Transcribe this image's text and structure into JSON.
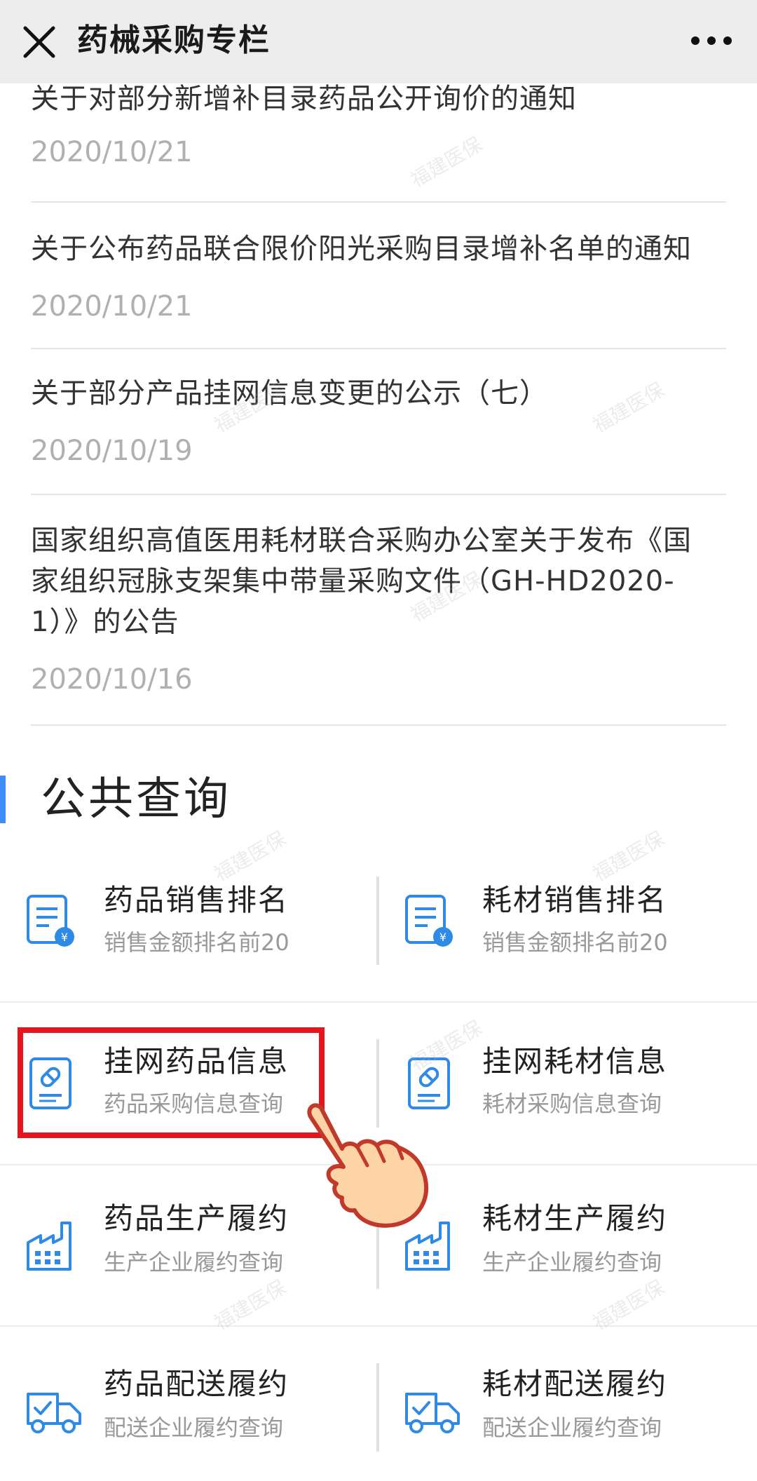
{
  "header": {
    "title": "药械采购专栏",
    "close_icon": "close-icon",
    "more_icon": "more-dots-icon"
  },
  "news": [
    {
      "title": "关于对部分新增补目录药品公开询价的通知",
      "date": "2020/10/21"
    },
    {
      "title": "关于公布药品联合限价阳光采购目录增补名单的通知",
      "date": "2020/10/21"
    },
    {
      "title": "关于部分产品挂网信息变更的公示（七）",
      "date": "2020/10/19"
    },
    {
      "title_line1": "国家组织高值医用耗材联合采购办公室关于发布《国",
      "title_line2": "家组织冠脉支架集中带量采购文件（GH-HD2020-",
      "title_line3": "1）》的公告",
      "date": "2020/10/16"
    }
  ],
  "section": {
    "title": "公共查询"
  },
  "tiles": [
    {
      "title": "药品销售排名",
      "sub": "销售金额排名前20",
      "icon": "receipt-yen-icon"
    },
    {
      "title": "耗材销售排名",
      "sub": "销售金额排名前20",
      "icon": "receipt-yen-icon"
    },
    {
      "title": "挂网药品信息",
      "sub": "药品采购信息查询",
      "icon": "pill-document-icon"
    },
    {
      "title": "挂网耗材信息",
      "sub": "耗材采购信息查询",
      "icon": "pill-document-icon"
    },
    {
      "title": "药品生产履约",
      "sub": "生产企业履约查询",
      "icon": "factory-icon"
    },
    {
      "title": "耗材生产履约",
      "sub": "生产企业履约查询",
      "icon": "factory-icon"
    },
    {
      "title": "药品配送履约",
      "sub": "配送企业履约查询",
      "icon": "delivery-truck-icon"
    },
    {
      "title": "耗材配送履约",
      "sub": "配送企业履约查询",
      "icon": "delivery-truck-icon"
    }
  ],
  "watermark": "福建医保",
  "colors": {
    "accent": "#3f8ef6",
    "highlight": "#e8141c",
    "icon_blue": "#2f8ae6"
  }
}
